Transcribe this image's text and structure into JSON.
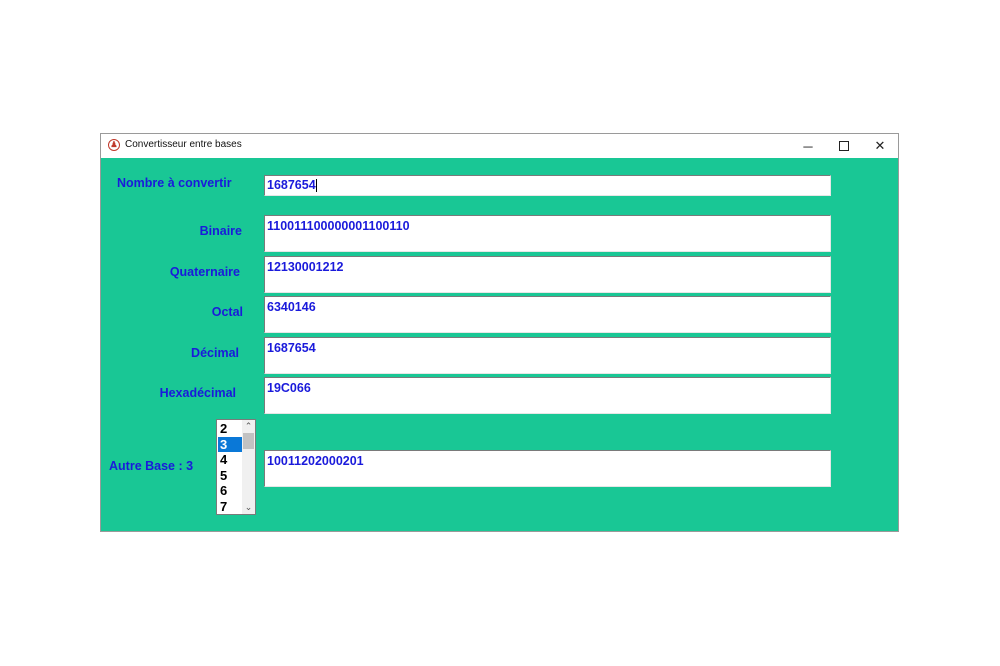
{
  "window": {
    "title": "Convertisseur entre bases",
    "minimize_glyph": "─",
    "close_glyph": "✕",
    "icon": "app-icon"
  },
  "form": {
    "input_label": "Nombre à convertir",
    "input_value": "1687654",
    "rows": [
      {
        "label": "Binaire",
        "value": "110011100000001100110"
      },
      {
        "label": "Quaternaire",
        "value": "12130001212"
      },
      {
        "label": "Octal",
        "value": "6340146"
      },
      {
        "label": "Décimal",
        "value": "1687654"
      },
      {
        "label": "Hexadécimal",
        "value": "19C066"
      }
    ],
    "other_base_label": "Autre Base : 3",
    "other_base_value": "10011202000201",
    "base_list": [
      "2",
      "3",
      "4",
      "5",
      "6",
      "7"
    ],
    "selected_base": "3"
  },
  "colors": {
    "background": "#19c795",
    "text": "#1a1adb",
    "selection": "#0a78d7"
  }
}
